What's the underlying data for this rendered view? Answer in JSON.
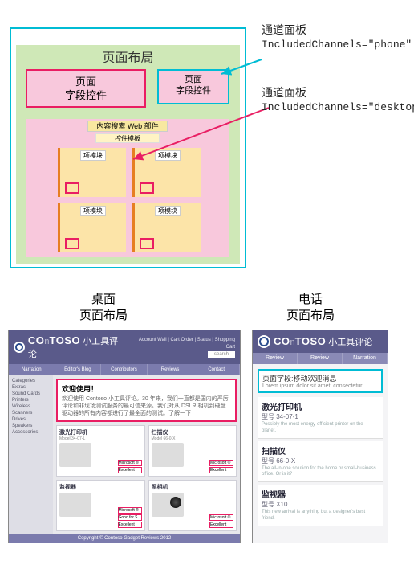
{
  "diagram": {
    "page_layout_title": "页面布局",
    "field_large": "页面\n字段控件",
    "field_small": "页面\n字段控件",
    "search_part_label": "内容搜索 Web 部件",
    "template_label": "控件模板",
    "cell_label": "项模块",
    "anno_phone_title": "通道面板",
    "anno_phone_attr": "IncludedChannels=\"phone\"",
    "anno_desktop_title": "通道面板",
    "anno_desktop_attr": "IncludedChannels=\"desktop\""
  },
  "titles": {
    "desktop_line1": "桌面",
    "desktop_line2": "页面布局",
    "phone_line1": "电话",
    "phone_line2": "页面布局"
  },
  "desktop": {
    "brand_prefix": "CO",
    "brand_suffix": "TOSO",
    "brand_sub": "小工具评论",
    "toplinks": "Account Wall  |  Cart Order  |  Status  |  Shopping Cart",
    "search_ph": "search",
    "nav": [
      "Narration",
      "Editor's Blog",
      "Contributors",
      "Reviews",
      "Contact"
    ],
    "sidebar": [
      "Categories",
      "Extras",
      "Sound Cards",
      "Printers",
      "Wireless",
      "Scanners",
      "Drives",
      "Speakers",
      "Accessories"
    ],
    "welcome_title": "欢迎使用！",
    "welcome_body": "欢迎使用 Contoso 小工具评论。30 年来，我们一直都是国内的严厉评论和非现场测试服务的最可信来源。我们对从 DSLR 相机到硬盘驱动器的所有内容都进行了最全面的测试。了解一下",
    "products": [
      {
        "name": "激光打印机",
        "model": "Model 34-07-L",
        "tags": [
          "Microsoft ®",
          "Excellent"
        ]
      },
      {
        "name": "扫描仪",
        "model": "Model 66-0-X",
        "tags": [
          "Microsoft ®",
          "Excellent"
        ]
      },
      {
        "name": "监视器",
        "model": "",
        "tags": [
          "Microsoft ®",
          "Good for $",
          "Excellent"
        ]
      },
      {
        "name": "照相机",
        "model": "",
        "tags": [
          "Microsoft ®",
          "Excellent"
        ]
      }
    ],
    "footer": "Copyright © Contoso Gadget Reviews 2012"
  },
  "phone": {
    "brand_prefix": "CO",
    "brand_suffix": "TOSO",
    "brand_sub": "小工具评论",
    "nav": [
      "Review",
      "Review",
      "Narration"
    ],
    "welcome_title": "页面字段:移动欢迎消息",
    "welcome_sub": "Lorem ipsum dolor sit amet, consectetur",
    "items": [
      {
        "name": "激光打印机",
        "model": "型号 34-07-1",
        "desc": "Possibly the most energy-efficient printer on the planet."
      },
      {
        "name": "扫描仪",
        "model": "型号 66-0-X",
        "desc": "The all-in-one solution for the home or small-business office. Or is it?"
      },
      {
        "name": "监视器",
        "model": "型号 X10",
        "desc": "This new arrival is anything but a designer's best friend."
      }
    ]
  }
}
